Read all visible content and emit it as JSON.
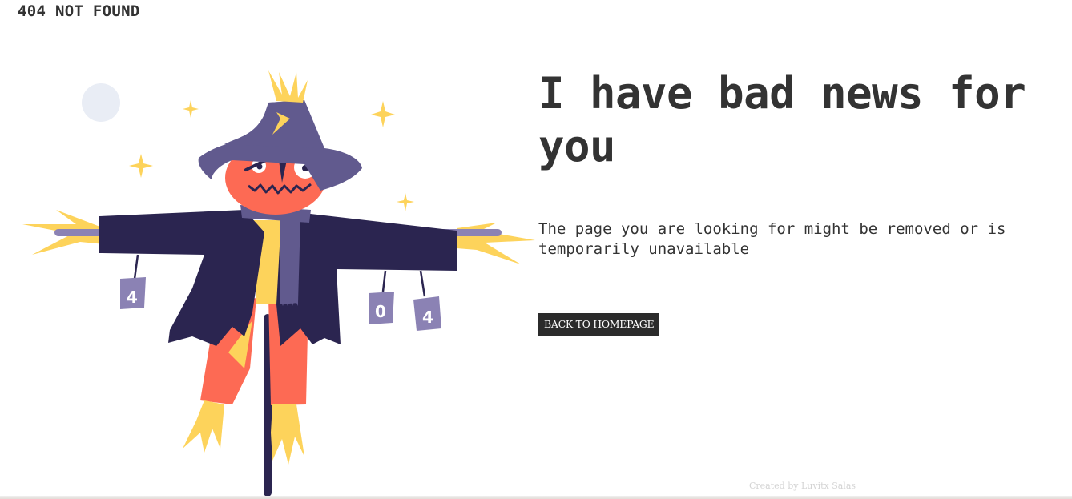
{
  "header": {
    "brand": "404 NOT FOUND"
  },
  "main": {
    "title": "I have bad news for you",
    "subtitle": "The page you are looking for might be removed or is temporarily unavailable",
    "back_button_label": "BACK TO HOMEPAGE"
  },
  "illustration": {
    "can_digits": [
      "4",
      "0",
      "4"
    ],
    "colors": {
      "moon": "#e9edf5",
      "star": "#fdd35b",
      "hat": "#615a8e",
      "face": "#fd6a54",
      "coat": "#2b2550",
      "scarf": "#615a8e",
      "straw": "#fdd35b",
      "pole": "#2b2550",
      "can": "#8b82b4"
    }
  },
  "footer": {
    "credit": "Created by Luvitx Salas"
  }
}
